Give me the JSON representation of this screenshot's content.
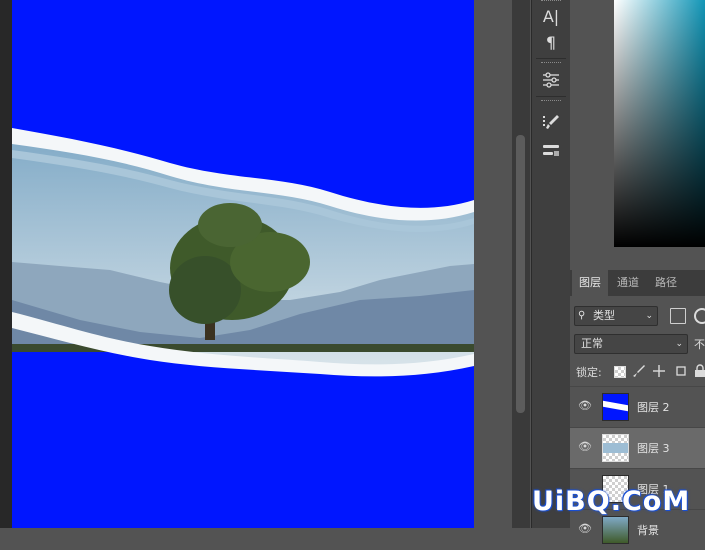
{
  "document": {
    "background_color": "#0016ff",
    "image_description_color_sky": "#9bb9cf"
  },
  "tools": {
    "items": [
      {
        "name": "character-icon",
        "glyph": "A|"
      },
      {
        "name": "paragraph-icon",
        "glyph": "¶"
      },
      {
        "name": "adjustments-icon",
        "glyph": "☰"
      },
      {
        "name": "brush-settings-icon",
        "glyph": "🖌"
      },
      {
        "name": "brush-presets-icon",
        "glyph": "⚒"
      }
    ]
  },
  "layers_panel": {
    "tabs": [
      "图层",
      "通道",
      "路径"
    ],
    "active_tab": "图层",
    "kind_filter": "类型",
    "blend_mode": "正常",
    "opacity_label": "不",
    "lock_label": "锁定:",
    "layers": [
      {
        "name": "图层 2",
        "thumb": "blue-torn",
        "selected": false
      },
      {
        "name": "图层 3",
        "thumb": "checker-torn",
        "selected": true
      },
      {
        "name": "图层 1",
        "thumb": "checker",
        "selected": false
      },
      {
        "name": "背景",
        "thumb": "photo",
        "selected": false
      }
    ]
  },
  "watermark": {
    "text": "UiBQ.CoM"
  },
  "colors": {
    "panel_bg": "#535353",
    "tab_bar": "#3c3c3c",
    "selected_row": "#6a6a6a",
    "canvas_blue": "#0016ff"
  }
}
